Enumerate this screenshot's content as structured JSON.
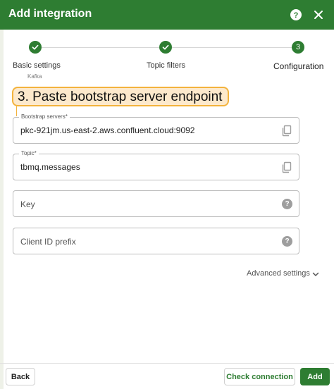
{
  "dialog": {
    "title": "Add integration"
  },
  "stepper": {
    "steps": [
      {
        "label": "Basic settings",
        "sublabel": "Kafka",
        "state": "completed"
      },
      {
        "label": "Topic filters",
        "state": "completed"
      },
      {
        "label": "Configuration",
        "number": "3",
        "state": "active"
      }
    ]
  },
  "annotation": {
    "text": "3. Paste bootstrap server endpoint"
  },
  "form": {
    "bootstrap_servers": {
      "label": "Bootstrap servers*",
      "value": "pkc-921jm.us-east-2.aws.confluent.cloud:9092"
    },
    "topic": {
      "label": "Topic*",
      "value": "tbmq.messages"
    },
    "key": {
      "placeholder": "Key"
    },
    "client_id_prefix": {
      "placeholder": "Client ID prefix"
    },
    "advanced_settings": {
      "label": "Advanced settings"
    }
  },
  "footer": {
    "back_label": "Back",
    "check_label": "Check connection",
    "add_label": "Add"
  },
  "icons": {
    "help": "help-icon",
    "close": "close-icon",
    "check": "check-icon",
    "copy": "copy-icon",
    "question": "question-circle-icon",
    "chevron": "chevron-down-icon"
  },
  "colors": {
    "primary": "#2e7d32",
    "callout_bg": "#fde9cc",
    "callout_border": "#f3b33d"
  }
}
